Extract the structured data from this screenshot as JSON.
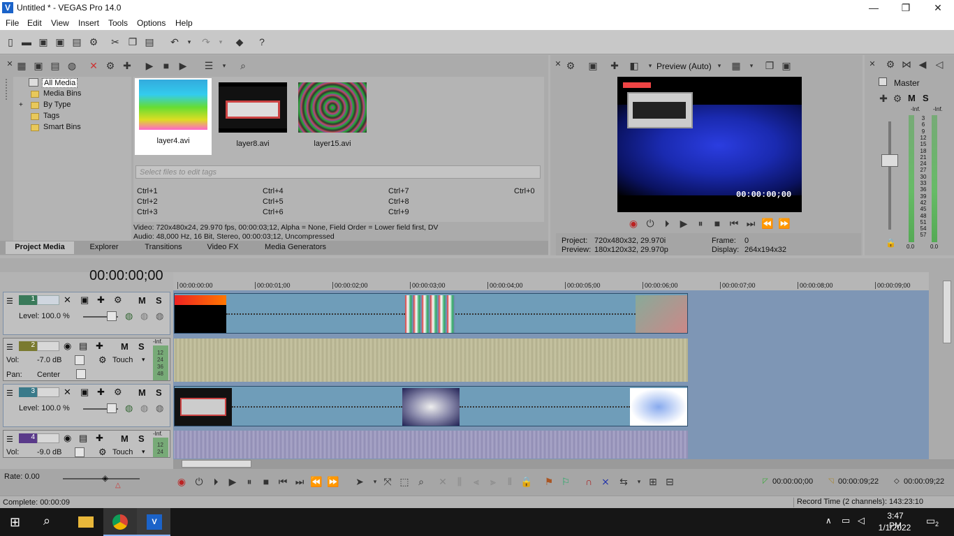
{
  "window": {
    "title": "Untitled * - VEGAS Pro 14.0",
    "logo": "V"
  },
  "window_controls": {
    "minimize": "—",
    "maximize": "❐",
    "close": "✕"
  },
  "menu": [
    "File",
    "Edit",
    "View",
    "Insert",
    "Tools",
    "Options",
    "Help"
  ],
  "media_tree": [
    "All Media",
    "Media Bins",
    "By Type",
    "Tags",
    "Smart Bins"
  ],
  "tree_expand": "+",
  "media_files": [
    {
      "name": "layer4.avi"
    },
    {
      "name": "layer8.avi"
    },
    {
      "name": "layer15.avi"
    }
  ],
  "tag_placeholder": "Select files to edit tags",
  "shortcuts": [
    [
      "Ctrl+1",
      "Ctrl+4",
      "Ctrl+7",
      "Ctrl+0"
    ],
    [
      "Ctrl+2",
      "Ctrl+5",
      "Ctrl+8",
      ""
    ],
    [
      "Ctrl+3",
      "Ctrl+6",
      "Ctrl+9",
      ""
    ]
  ],
  "media_info": {
    "video": "Video: 720x480x24, 29.970 fps, 00:00:03;12, Alpha = None, Field Order = Lower field first, DV",
    "audio": "Audio: 48,000 Hz, 16 Bit, Stereo, 00:00:03;12, Uncompressed"
  },
  "tabs": [
    "Project Media",
    "Explorer",
    "Transitions",
    "Video FX",
    "Media Generators"
  ],
  "preview": {
    "mode": "Preview (Auto)",
    "timecode": "00:00:00;00",
    "project_label": "Project:",
    "project_value": "720x480x32, 29.970i",
    "preview_label": "Preview:",
    "preview_value": "180x120x32, 29.970p",
    "frame_label": "Frame:",
    "frame_value": "0",
    "display_label": "Display:",
    "display_value": "264x194x32"
  },
  "master": {
    "label": "Master",
    "m": "M",
    "s": "S",
    "inf_left": "-Inf.",
    "inf_right": "-Inf.",
    "scale": [
      "3",
      "6",
      "9",
      "12",
      "15",
      "18",
      "21",
      "24",
      "27",
      "30",
      "33",
      "36",
      "39",
      "42",
      "45",
      "48",
      "51",
      "54",
      "57"
    ],
    "bottom_left": "0.0",
    "bottom_right": "0.0"
  },
  "timeline": {
    "cursor": "00:00:00;00",
    "ruler": [
      "00:00:00:00",
      "00:00:01;00",
      "00:00:02;00",
      "00:00:03;00",
      "00:00:04;00",
      "00:00:05;00",
      "00:00:06;00",
      "00:00:07;00",
      "00:00:08;00",
      "00:00:09;00"
    ]
  },
  "tracks": [
    {
      "num": "1",
      "type": "video",
      "level": "Level: 100.0 %",
      "m": "M",
      "s": "S"
    },
    {
      "num": "2",
      "type": "audio",
      "vol_label": "Vol:",
      "vol": "-7.0 dB",
      "pan_label": "Pan:",
      "pan": "Center",
      "mode": "Touch",
      "m": "M",
      "s": "S",
      "inf": "-Inf.",
      "scale": [
        "12",
        "24",
        "36",
        "48"
      ]
    },
    {
      "num": "3",
      "type": "video",
      "level": "Level: 100.0 %",
      "m": "M",
      "s": "S"
    },
    {
      "num": "4",
      "type": "audio",
      "vol_label": "Vol:",
      "vol": "-9.0 dB",
      "mode": "Touch",
      "m": "M",
      "s": "S",
      "inf": "-Inf.",
      "scale": [
        "12",
        "24"
      ]
    }
  ],
  "rate": "Rate: 0.00",
  "transport_times": {
    "start": "00:00:00;00",
    "end": "00:00:09;22",
    "length": "00:00:09;22"
  },
  "status": {
    "complete": "Complete: 00:00:09",
    "record_time": "Record Time (2 channels): 143:23:10"
  },
  "taskbar": {
    "time": "3:47 PM",
    "date": "1/1/2022",
    "notifications": "2"
  },
  "colors": {
    "accent": "#1b63c9",
    "timeline_bg": "#7e96b5",
    "video_clip": "#6d9ab8",
    "audio_clip": "#c9c6a2"
  }
}
